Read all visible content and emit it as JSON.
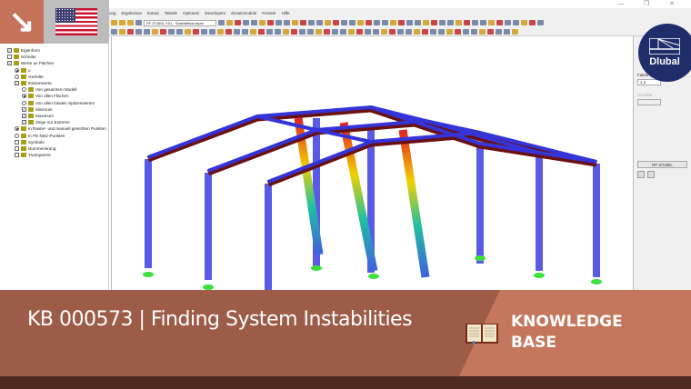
{
  "corner_icon": "arrow-down-right",
  "flag": "us-flag",
  "app": {
    "menu": [
      "ung",
      "Ergebnisse",
      "Extras",
      "Tabelle",
      "Optionen",
      "Developers",
      "Zusatzmodule",
      "Fenster",
      "Hilfe"
    ],
    "case_combo": "RF-STABIL FA1 - Stabilitätsanalyse"
  },
  "tree": [
    {
      "label": "Eigenform",
      "ctrl": "cb",
      "checked": true,
      "indent": 0
    },
    {
      "label": "Schnitte",
      "ctrl": "cb",
      "checked": false,
      "indent": 0
    },
    {
      "label": "Werte an Flächen",
      "ctrl": "cb",
      "checked": true,
      "indent": 0
    },
    {
      "label": "u",
      "ctrl": "rb",
      "checked": true,
      "indent": 1
    },
    {
      "label": "Gezielte",
      "ctrl": "rb",
      "checked": false,
      "indent": 1
    },
    {
      "label": "Extremwerte",
      "ctrl": "cb",
      "checked": true,
      "indent": 1
    },
    {
      "label": "Von gesamtem Modell",
      "ctrl": "rb",
      "checked": false,
      "indent": 2
    },
    {
      "label": "Von allen Flächen",
      "ctrl": "rb",
      "checked": true,
      "indent": 2
    },
    {
      "label": "Von allen lokalen Spitzenwerten",
      "ctrl": "rb",
      "checked": false,
      "indent": 2
    },
    {
      "label": "Minimum",
      "ctrl": "cb",
      "checked": true,
      "indent": 2
    },
    {
      "label": "Maximum",
      "ctrl": "cb",
      "checked": true,
      "indent": 2
    },
    {
      "label": "Zeige nur Extreme",
      "ctrl": "cb",
      "checked": true,
      "indent": 2
    },
    {
      "label": "In Raster- und manuell gesetzten Punkten",
      "ctrl": "rb",
      "checked": true,
      "indent": 1
    },
    {
      "label": "In FE-Netz-Punkten",
      "ctrl": "rb",
      "checked": false,
      "indent": 1
    },
    {
      "label": "Symbole",
      "ctrl": "cb",
      "checked": false,
      "indent": 1
    },
    {
      "label": "Nummerierung",
      "ctrl": "cb",
      "checked": false,
      "indent": 1
    },
    {
      "label": "Transparent",
      "ctrl": "cb",
      "checked": false,
      "indent": 1
    }
  ],
  "right_panel": {
    "faktor_label": "Faktor",
    "faktor_value": "1.2",
    "schnitt_label": "Schnitte",
    "module_button": "RF-STABIL"
  },
  "logo": {
    "text": "Dlubal"
  },
  "banner": {
    "title": "KB 000573 | Finding System Instabilities",
    "kb_line1": "KNOWLEDGE",
    "kb_line2": "BASE"
  },
  "colors": {
    "accent": "#c4735a",
    "banner": "#9c5c47",
    "banner_right": "#c4775c",
    "dark": "#4e2a1f",
    "logo": "#1f2d6a"
  }
}
